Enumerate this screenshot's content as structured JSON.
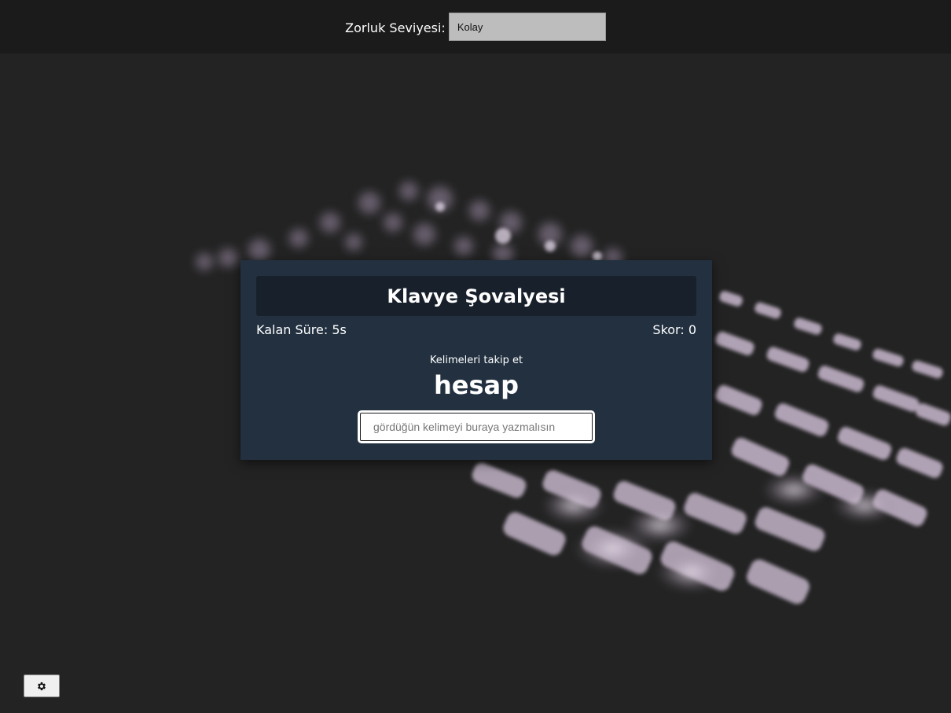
{
  "header": {
    "difficulty_label": "Zorluk Seviyesi:",
    "difficulty_value": "Kolay"
  },
  "game": {
    "title": "Klavye Şovalyesi",
    "time_left": "Kalan Süre: 5s",
    "score": "Skor: 0",
    "instruction": "Kelimeleri takip et",
    "current_word": "hesap",
    "input_placeholder": "gördüğün kelimeyi buraya yazmalısın",
    "input_value": ""
  },
  "settings_button": {
    "icon": "gear-icon"
  },
  "colors": {
    "page_background": "#232323",
    "topbar_background": "#1b1b1b",
    "card_background": "#223040",
    "title_bar_background": "#18202c",
    "select_background": "#bdbdbd"
  }
}
